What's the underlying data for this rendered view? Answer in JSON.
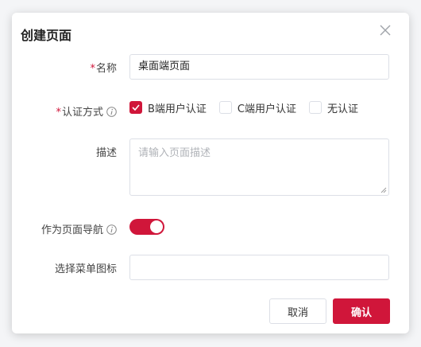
{
  "dialog": {
    "title": "创建页面",
    "close_icon": "close-icon"
  },
  "form": {
    "name": {
      "required_mark": "*",
      "label": "名称",
      "value": "桌面端页面"
    },
    "auth": {
      "required_mark": "*",
      "label": "认证方式",
      "info_icon": "info-icon",
      "options": [
        {
          "label": "B端用户认证",
          "checked": true
        },
        {
          "label": "C端用户认证",
          "checked": false
        },
        {
          "label": "无认证",
          "checked": false
        }
      ]
    },
    "description": {
      "label": "描述",
      "placeholder": "请输入页面描述",
      "value": ""
    },
    "navigation": {
      "label": "作为页面导航",
      "info_icon": "info-icon",
      "enabled": true
    },
    "menu_icon": {
      "label": "选择菜单图标",
      "value": ""
    }
  },
  "footer": {
    "cancel_label": "取消",
    "confirm_label": "确认"
  },
  "colors": {
    "accent": "#d0163a",
    "border": "#dcdfe6",
    "placeholder": "#b0b3b8"
  }
}
